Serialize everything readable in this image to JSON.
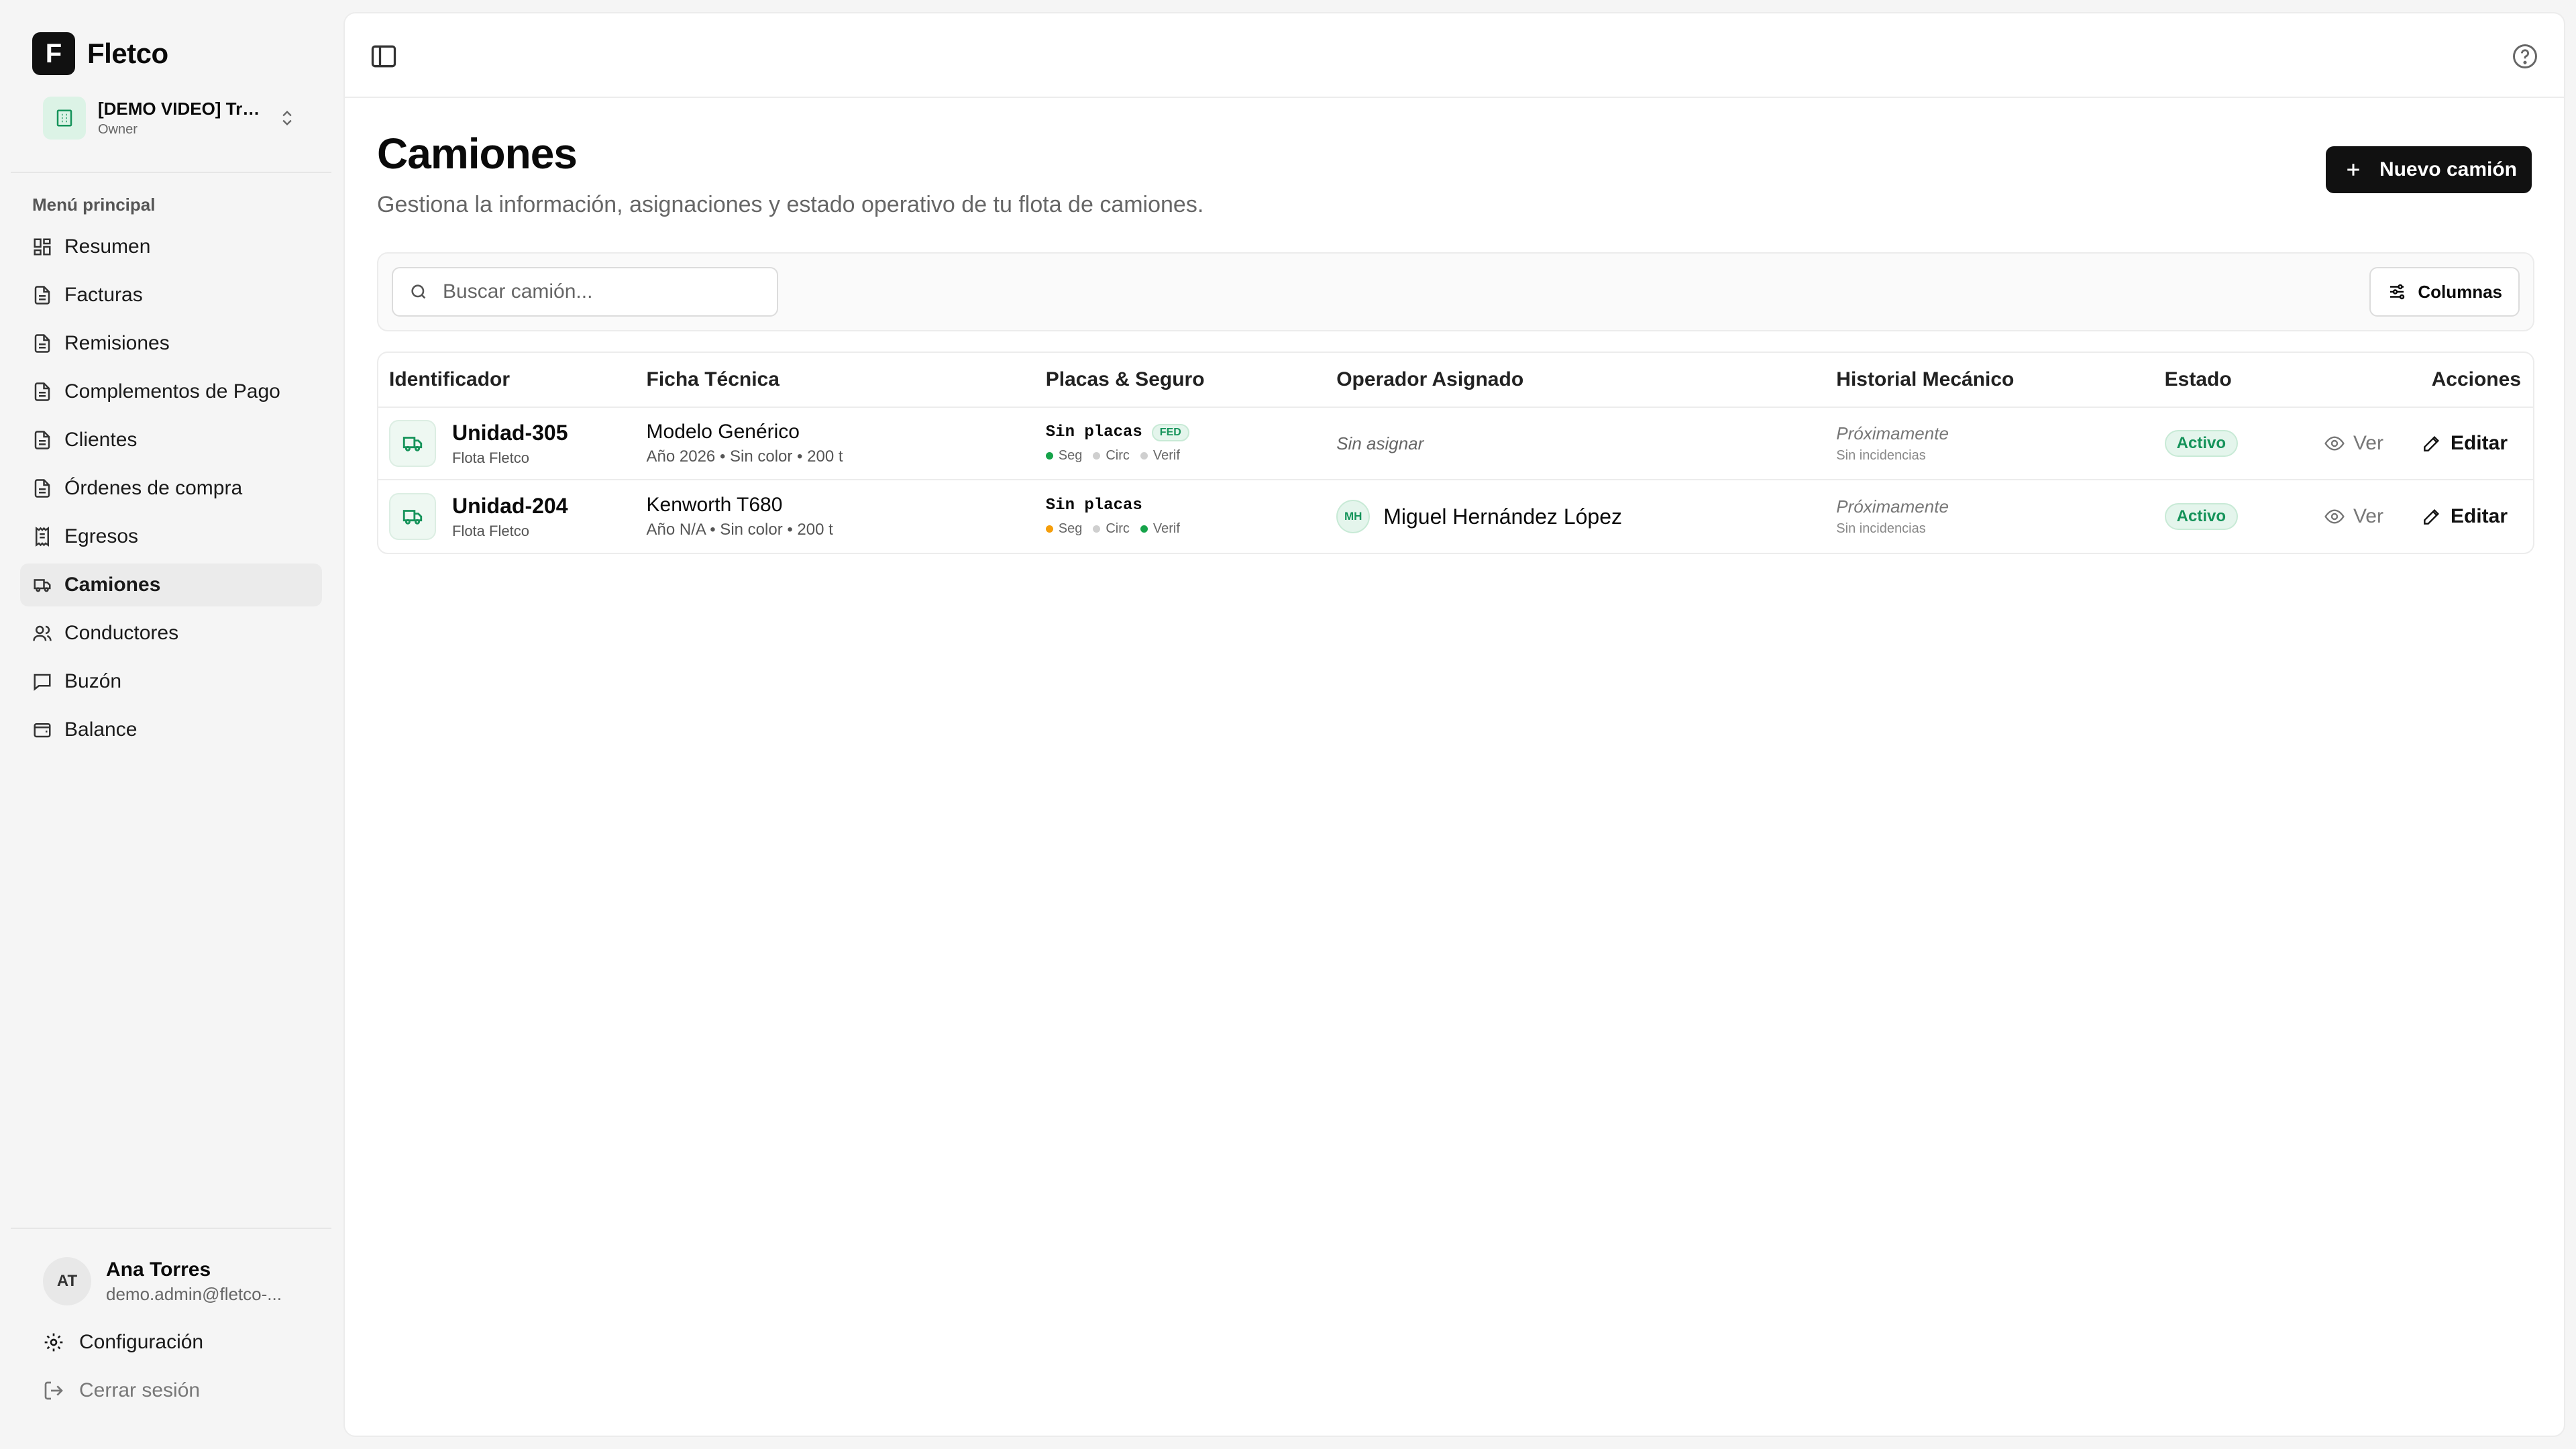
{
  "brand": {
    "logo_letter": "F",
    "name": "Fletco"
  },
  "org": {
    "name": "[DEMO VIDEO] Tra...",
    "role": "Owner"
  },
  "menu": {
    "title": "Menú principal",
    "items": [
      {
        "label": "Resumen",
        "icon": "dashboard-icon"
      },
      {
        "label": "Facturas",
        "icon": "document-icon"
      },
      {
        "label": "Remisiones",
        "icon": "document-icon"
      },
      {
        "label": "Complementos de Pago",
        "icon": "document-icon"
      },
      {
        "label": "Clientes",
        "icon": "document-icon"
      },
      {
        "label": "Órdenes de compra",
        "icon": "document-icon"
      },
      {
        "label": "Egresos",
        "icon": "receipt-icon"
      },
      {
        "label": "Camiones",
        "icon": "truck-icon",
        "active": true
      },
      {
        "label": "Conductores",
        "icon": "users-icon"
      },
      {
        "label": "Buzón",
        "icon": "message-icon"
      },
      {
        "label": "Balance",
        "icon": "wallet-icon"
      }
    ]
  },
  "user": {
    "initials": "AT",
    "name": "Ana Torres",
    "email": "demo.admin@fletco-..."
  },
  "footer": {
    "settings_label": "Configuración",
    "logout_label": "Cerrar sesión"
  },
  "page": {
    "title": "Camiones",
    "subtitle": "Gestiona la información, asignaciones y estado operativo de tu flota de camiones.",
    "new_button": "Nuevo camión"
  },
  "search": {
    "placeholder": "Buscar camión..."
  },
  "columns_button": "Columnas",
  "table": {
    "headers": [
      "Identificador",
      "Ficha Técnica",
      "Placas & Seguro",
      "Operador Asignado",
      "Historial Mecánico",
      "Estado",
      "Acciones"
    ],
    "rows": [
      {
        "unit": "Unidad-305",
        "fleet": "Flota Fletco",
        "model": "Modelo Genérico",
        "spec": "Año 2026 • Sin color • 200 t",
        "plates": "Sin placas",
        "plate_badge": "FED",
        "docs": [
          {
            "label": "Seg",
            "color": "#16a34a"
          },
          {
            "label": "Circ",
            "color": "#cfcfcf"
          },
          {
            "label": "Verif",
            "color": "#cfcfcf"
          }
        ],
        "operator": "Sin asignar",
        "operator_initials": "",
        "history": "Próximamente",
        "history_sub": "Sin incidencias",
        "status": "Activo",
        "view_label": "Ver",
        "edit_label": "Editar"
      },
      {
        "unit": "Unidad-204",
        "fleet": "Flota Fletco",
        "model": "Kenworth T680",
        "spec": "Año N/A • Sin color • 200 t",
        "plates": "Sin placas",
        "plate_badge": "",
        "docs": [
          {
            "label": "Seg",
            "color": "#f59e0b"
          },
          {
            "label": "Circ",
            "color": "#cfcfcf"
          },
          {
            "label": "Verif",
            "color": "#16a34a"
          }
        ],
        "operator": "Miguel Hernández López",
        "operator_initials": "MH",
        "history": "Próximamente",
        "history_sub": "Sin incidencias",
        "status": "Activo",
        "view_label": "Ver",
        "edit_label": "Editar"
      }
    ]
  },
  "colors": {
    "accent": "#15935a",
    "primary_button": "#111111"
  }
}
